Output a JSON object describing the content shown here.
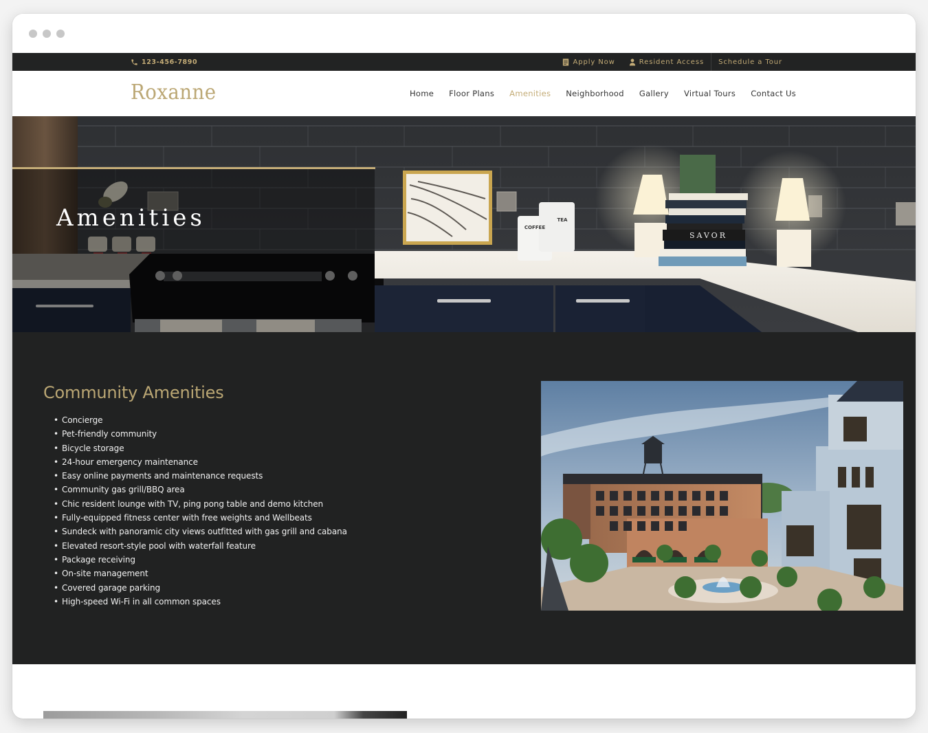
{
  "window": {
    "controls": [
      "close",
      "minimize",
      "maximize"
    ]
  },
  "utility_bar": {
    "phone": {
      "icon": "phone-icon",
      "number": "123-456-7890"
    },
    "links": [
      {
        "icon": "document-icon",
        "label": "Apply Now"
      },
      {
        "icon": "user-icon",
        "label": "Resident Access"
      },
      {
        "icon": null,
        "label": "Schedule a Tour"
      }
    ]
  },
  "nav": {
    "logo": "Roxanne",
    "items": [
      {
        "label": "Home",
        "active": false
      },
      {
        "label": "Floor Plans",
        "active": false
      },
      {
        "label": "Amenities",
        "active": true
      },
      {
        "label": "Neighborhood",
        "active": false
      },
      {
        "label": "Gallery",
        "active": false
      },
      {
        "label": "Virtual Tours",
        "active": false
      },
      {
        "label": "Contact Us",
        "active": false
      }
    ]
  },
  "hero": {
    "title": "Amenities",
    "image": "kitchen-counter-photo",
    "canister_labels": [
      "COFFEE",
      "TEA"
    ],
    "book_spine": "SAVOR"
  },
  "community": {
    "heading": "Community Amenities",
    "items": [
      "Concierge",
      "Pet-friendly community",
      "Bicycle storage",
      "24-hour emergency maintenance",
      "Easy online payments and maintenance requests",
      "Community gas grill/BBQ area",
      "Chic resident lounge with TV, ping pong table and demo kitchen",
      "Fully-equipped fitness center with free weights and Wellbeats",
      "Sundeck with panoramic city views outfitted with gas grill and cabana",
      "Elevated resort-style pool with waterfall feature",
      "Package receiving",
      "On-site management",
      "Covered garage parking",
      "High-speed Wi-Fi in all common spaces"
    ],
    "image": "building-plaza-rendering"
  },
  "colors": {
    "accent_gold": "#c4ac77",
    "logo_gold": "#bba774",
    "dark_bg": "#212222",
    "utility_bg": "#222323"
  }
}
